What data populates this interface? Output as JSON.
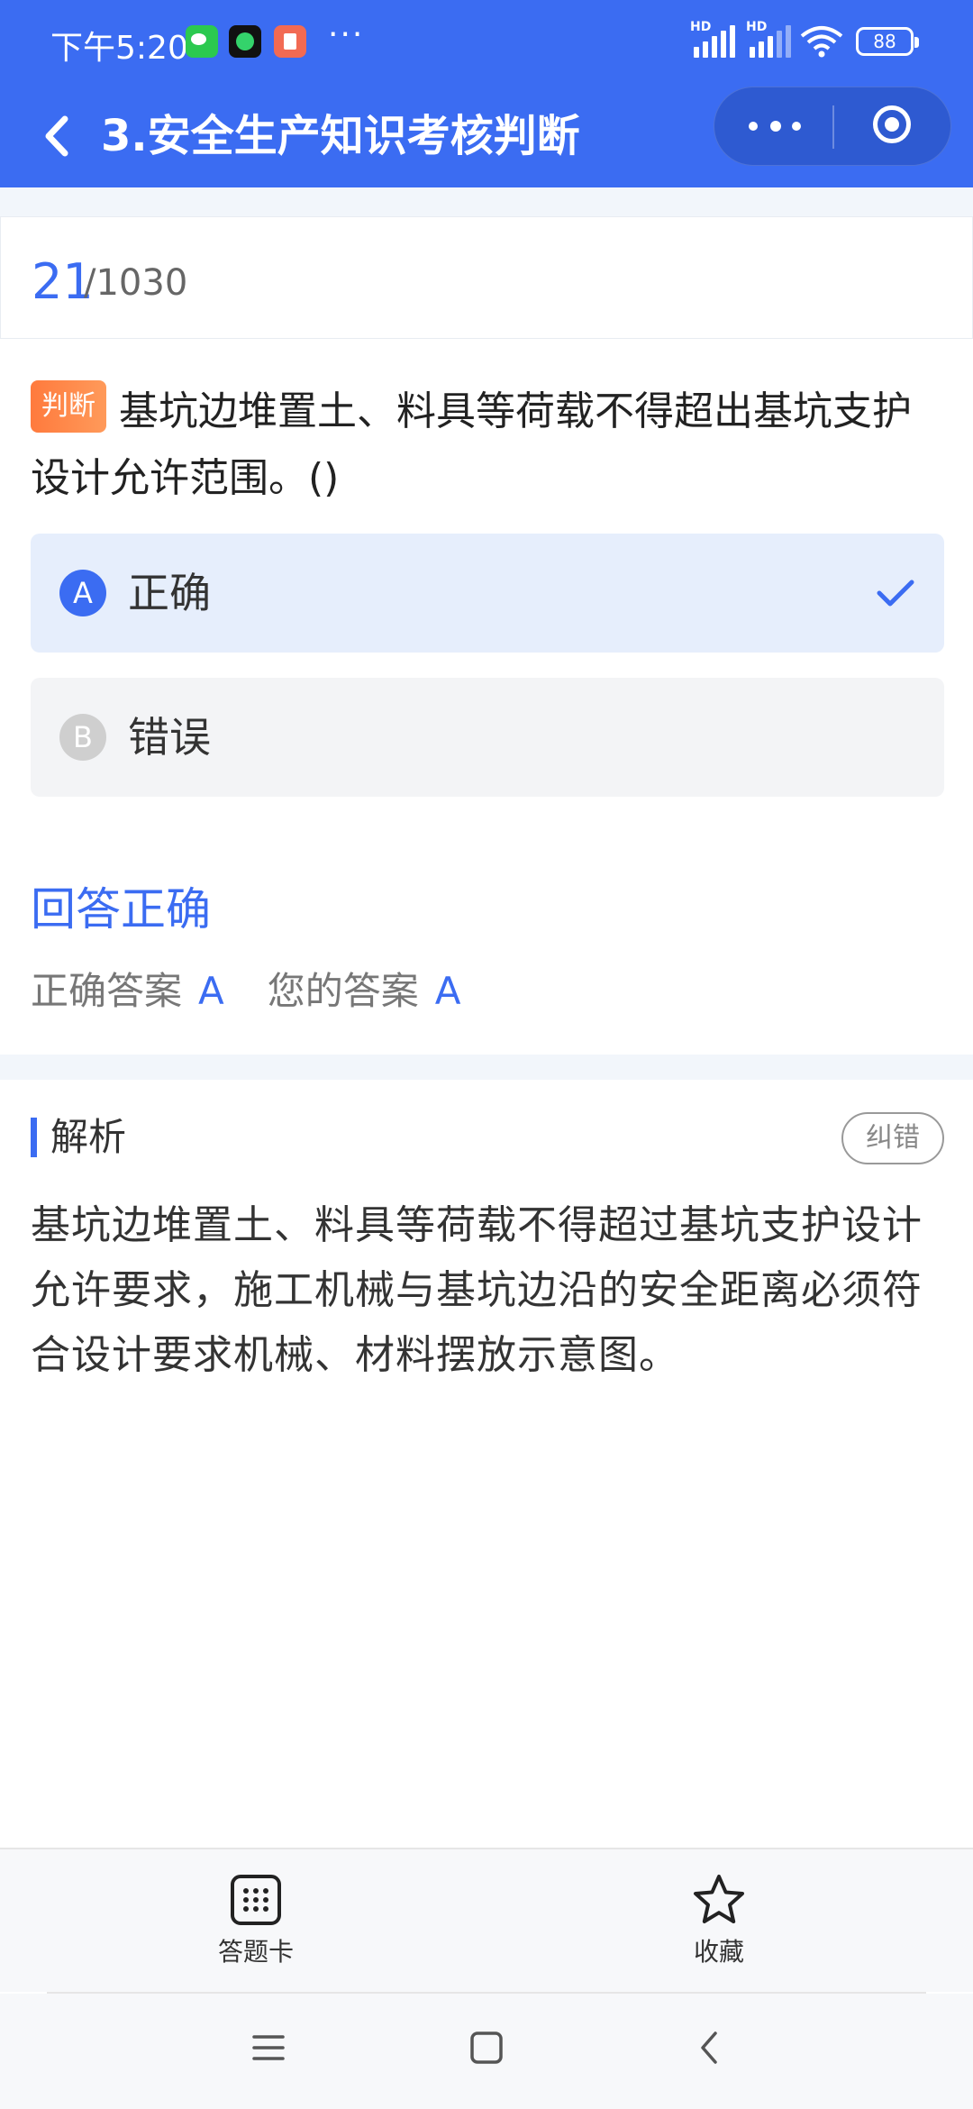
{
  "status_bar": {
    "time": "下午5:20",
    "more": "···",
    "hd1": "HD",
    "hd2": "HD",
    "battery": "88"
  },
  "nav": {
    "title": "3.安全生产知识考核判断"
  },
  "progress": {
    "current": "21",
    "total": "/1030"
  },
  "question": {
    "tag": "判断",
    "text": "基坑边堆置土、料具等荷载不得超出基坑支护设计允许范围。()"
  },
  "options": [
    {
      "letter": "A",
      "text": "正确",
      "selected": true
    },
    {
      "letter": "B",
      "text": "错误",
      "selected": false
    }
  ],
  "result": {
    "title": "回答正确",
    "correct_label": "正确答案",
    "correct_value": "A",
    "your_label": "您的答案",
    "your_value": "A"
  },
  "analysis": {
    "title": "解析",
    "report_button": "纠错",
    "text": "基坑边堆置土、料具等荷载不得超过基坑支护设计允许要求，施工机械与基坑边沿的安全距离必须符合设计要求机械、材料摆放示意图。"
  },
  "bottom_tools": {
    "answer_card": "答题卡",
    "favorite": "收藏"
  },
  "colors": {
    "accent": "#3b6cf2",
    "tag": "#ff7a3d",
    "selected_bg": "#e6eefc"
  }
}
